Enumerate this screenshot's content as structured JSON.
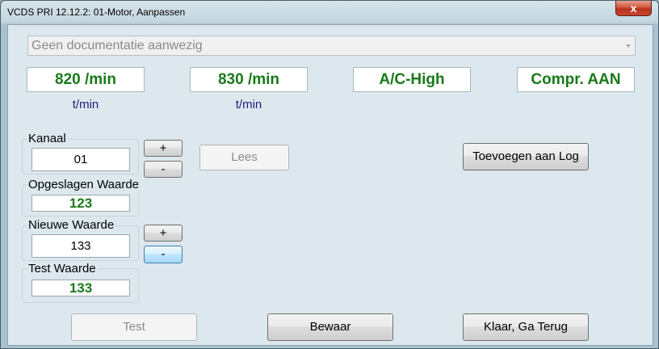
{
  "window": {
    "title": "VCDS PRI 12.12.2: 01-Motor,  Aanpassen",
    "close_label": "x"
  },
  "doc_combo": {
    "selected": "Geen documentatie aanwezig"
  },
  "readouts": [
    {
      "value": "820 /min",
      "unit": "t/min"
    },
    {
      "value": "830 /min",
      "unit": "t/min"
    },
    {
      "value": "A/C-High",
      "unit": ""
    },
    {
      "value": "Compr. AAN",
      "unit": ""
    }
  ],
  "kanaal": {
    "label": "Kanaal",
    "value": "01",
    "plus": "+",
    "minus": "-"
  },
  "opgeslagen": {
    "label": "Opgeslagen Waarde",
    "value": "123"
  },
  "nieuwe": {
    "label": "Nieuwe Waarde",
    "value": "133",
    "plus": "+",
    "minus": "-"
  },
  "test_waarde": {
    "label": "Test Waarde",
    "value": "133"
  },
  "buttons": {
    "lees": "Lees",
    "log": "Toevoegen aan Log",
    "test": "Test",
    "bewaar": "Bewaar",
    "klaar": "Klaar, Ga Terug"
  },
  "colors": {
    "value_green": "#1a7a1a",
    "unit_blue": "#1a237e",
    "close_red": "#c8472d"
  }
}
